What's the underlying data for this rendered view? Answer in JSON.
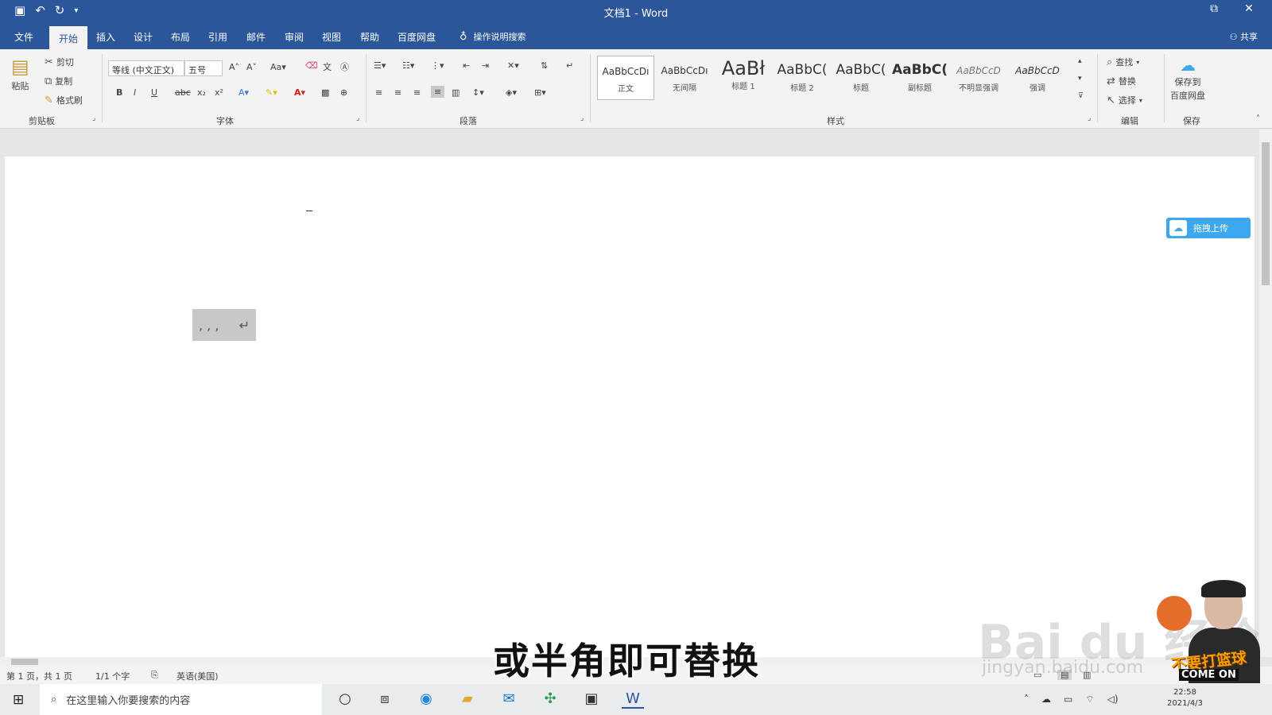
{
  "titlebar": {
    "title": "文档1 - Word",
    "qat": {
      "save_icon": "floppy-icon",
      "undo_icon": "undo-icon",
      "redo_icon": "redo-icon",
      "custom_icon": "dropdown-icon"
    },
    "controls": {
      "restore": "⧉",
      "close": "✕"
    }
  },
  "tabs": [
    {
      "label": "文件"
    },
    {
      "label": "开始"
    },
    {
      "label": "插入"
    },
    {
      "label": "设计"
    },
    {
      "label": "布局"
    },
    {
      "label": "引用"
    },
    {
      "label": "邮件"
    },
    {
      "label": "审阅"
    },
    {
      "label": "视图"
    },
    {
      "label": "帮助"
    },
    {
      "label": "百度网盘"
    }
  ],
  "tell_me": "操作说明搜索",
  "share": "共享",
  "ribbon": {
    "clipboard": {
      "paste": "粘贴",
      "cut": "剪切",
      "copy": "复制",
      "format_painter": "格式刷",
      "label": "剪贴板"
    },
    "font": {
      "font_name": "等线 (中文正文)",
      "font_size": "五号",
      "label": "字体"
    },
    "paragraph": {
      "label": "段落"
    },
    "styles": {
      "label": "样式",
      "items": [
        {
          "preview": "AaBbCcDı",
          "name": "正文"
        },
        {
          "preview": "AaBbCcDı",
          "name": "无间隔"
        },
        {
          "preview": "AaBł",
          "name": "标题 1"
        },
        {
          "preview": "AaBbC(",
          "name": "标题 2"
        },
        {
          "preview": "AaBbC(",
          "name": "标题"
        },
        {
          "preview": "AaBbC(",
          "name": "副标题"
        },
        {
          "preview": "AaBbCcD",
          "name": "不明显强调"
        },
        {
          "preview": "AaBbCcD",
          "name": "强调"
        }
      ]
    },
    "editing": {
      "find": "查找",
      "replace": "替换",
      "select": "选择",
      "label": "编辑"
    },
    "save": {
      "button": "保存到",
      "button2": "百度网盘",
      "label": "保存"
    }
  },
  "document": {
    "selection_text": ", , ,",
    "upload_label": "拖拽上传"
  },
  "statusbar": {
    "page": "第 1 页，共 1 页",
    "words": "1/1 个字",
    "language": "英语(美国)"
  },
  "taskbar": {
    "search_placeholder": "在这里输入你要搜索的内容",
    "time": "22:58",
    "date": "2021/4/3"
  },
  "overlay": {
    "subtitle": "或半角即可替换",
    "watermark": "Bai du 经验",
    "watermark_url": "jingyan.baidu.com",
    "brand": "不要打篮球",
    "brand2": "COME ON"
  }
}
